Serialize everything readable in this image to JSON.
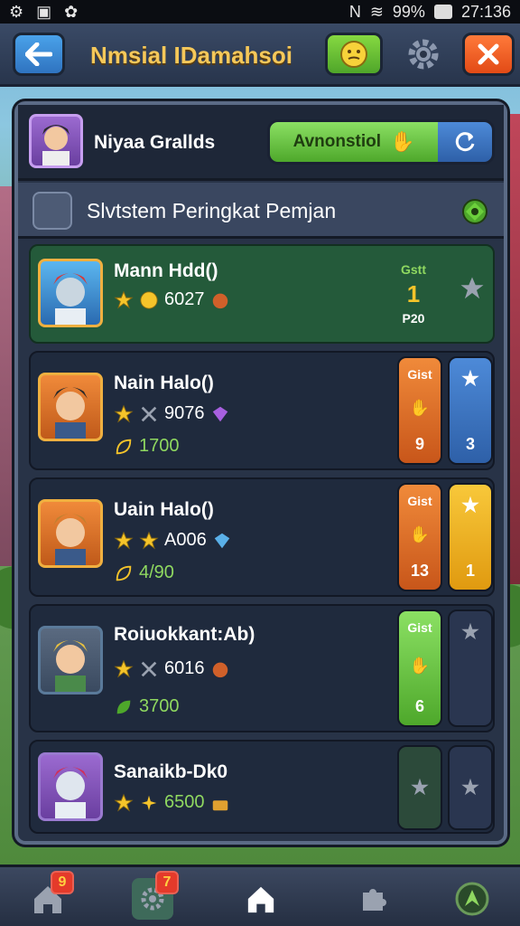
{
  "status_bar": {
    "left_icons": [
      "gear-icon",
      "image-icon",
      "paw-icon"
    ],
    "signal": "N",
    "battery": "99%",
    "time": "27:136"
  },
  "top_bar": {
    "title": "Nmsial IDamahsoi"
  },
  "user": {
    "name": "Niyaa Grallds",
    "announcement_label": "Avnonstiol"
  },
  "section": {
    "title": "Slvtstem Peringkat Pemjan"
  },
  "players": [
    {
      "name": "Mann Hdd()",
      "score": "6027",
      "rank_label": "Gstt",
      "rank": "1",
      "rank_sub": "P20",
      "stars": 1
    },
    {
      "name": "Nain Halo()",
      "score": "9076",
      "secondary": "1700",
      "chip_label": "Gist",
      "chip_value": "9",
      "star_value": "3",
      "stars": 1
    },
    {
      "name": "Uain Halo()",
      "score": "A006",
      "secondary": "4/90",
      "chip_label": "Gist",
      "chip_value": "13",
      "star_value": "1",
      "stars": 2
    },
    {
      "name": "Roiuokkant:Ab)",
      "score": "6016",
      "secondary": "3700",
      "chip_label": "Gist",
      "chip_value": "6",
      "stars": 1
    },
    {
      "name": "Sanaikb-Dk0",
      "score": "6500",
      "stars": 2
    }
  ],
  "bottom_nav": {
    "home_badge": "9",
    "settings_badge": "7"
  },
  "colors": {
    "accent_green": "#4ea82b",
    "accent_orange": "#e2681e",
    "accent_blue": "#2e60a8",
    "accent_yellow": "#f2b21c"
  }
}
